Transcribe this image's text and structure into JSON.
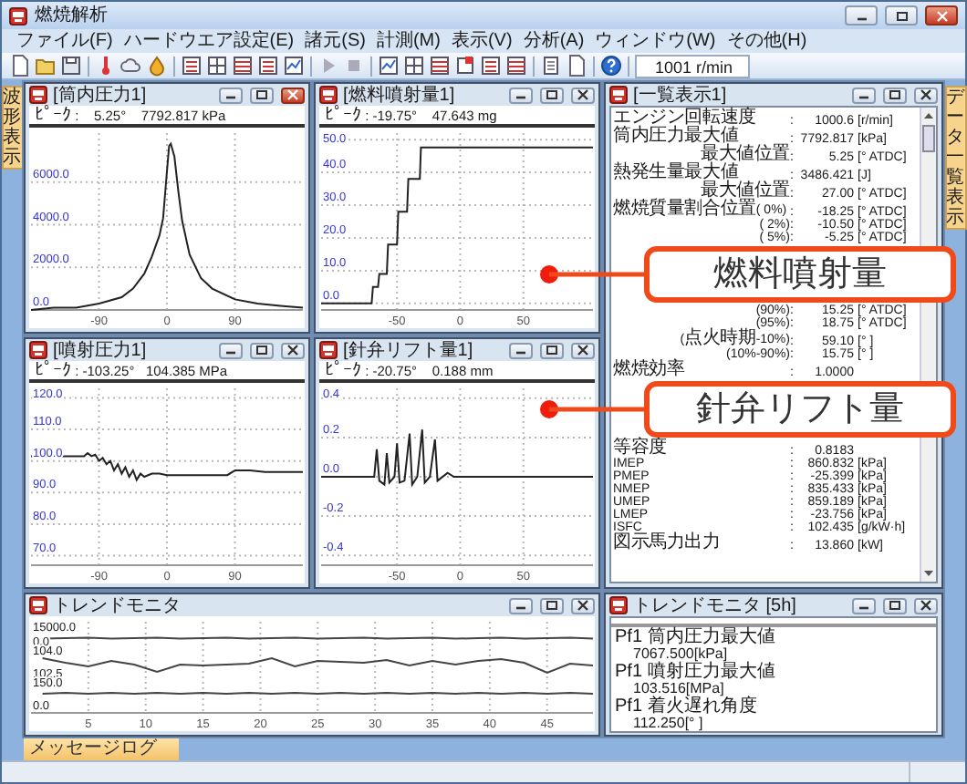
{
  "window": {
    "title": "燃焼解析"
  },
  "menu": [
    "ファイル(F)",
    "ハードウエア設定(E)",
    "諸元(S)",
    "計測(M)",
    "表示(V)",
    "分析(A)",
    "ウィンドウ(W)",
    "その他(H)"
  ],
  "toolbar": {
    "speed_field": "1001 r/min"
  },
  "side_tabs": {
    "left": {
      "label": "波形表示"
    },
    "right": {
      "label": "データ一覧表示"
    }
  },
  "charts": [
    {
      "title": "[筒内圧力1]",
      "active": true,
      "peak": "ﾋﾟｰｸ :    5.25°    7792.817 kPa",
      "chart_data": {
        "type": "line",
        "grid": true,
        "x": [
          -180,
          -150,
          -120,
          -90,
          -60,
          -45,
          -30,
          -20,
          -10,
          -5,
          0,
          3,
          5,
          10,
          15,
          20,
          30,
          45,
          60,
          90,
          120,
          150,
          180
        ],
        "series": [
          {
            "color": "#222222",
            "values": [
              0,
              100,
              100,
              300,
              600,
              1000,
              1700,
              2500,
              3500,
              4300,
              6500,
              7700,
              7800,
              7200,
              5600,
              4200,
              2600,
              1500,
              1000,
              500,
              300,
              200,
              100
            ]
          }
        ],
        "xlim": [
          -180,
          180
        ],
        "ylim": [
          0,
          8300
        ],
        "xticks": [
          -90,
          0,
          90
        ],
        "yticks": [
          {
            "value": 0,
            "label": "0.0"
          },
          {
            "value": 2000,
            "label": "2000.0"
          },
          {
            "value": 4000,
            "label": "4000.0"
          },
          {
            "value": 6000,
            "label": "6000.0"
          }
        ]
      }
    },
    {
      "title": "[燃料噴射量1]",
      "active": false,
      "peak": "ﾋﾟｰｸ : -19.75°    47.643 mg",
      "chart_data": {
        "type": "line",
        "grid": true,
        "x": [
          -110,
          -70,
          -69,
          -65,
          -64,
          -58,
          -57,
          -50,
          -49,
          -42,
          -41,
          -32,
          -31,
          105
        ],
        "series": [
          {
            "color": "#222222",
            "values": [
              0,
              0,
              5,
              5,
              9,
              9,
              18,
              18,
              28,
              28,
              38,
              38,
              47.6,
              47.6
            ]
          }
        ],
        "xlim": [
          -110,
          105
        ],
        "ylim": [
          -2,
          52
        ],
        "xticks": [
          -50,
          0,
          50
        ],
        "yticks": [
          {
            "value": 0,
            "label": "0.0"
          },
          {
            "value": 10,
            "label": "10.0"
          },
          {
            "value": 20,
            "label": "20.0"
          },
          {
            "value": 30,
            "label": "30.0"
          },
          {
            "value": 40,
            "label": "40.0"
          },
          {
            "value": 50,
            "label": "50.0"
          }
        ]
      }
    },
    {
      "title": "[噴射圧力1]",
      "active": false,
      "peak": "ﾋﾟｰｸ : -103.25°   104.385 MPa",
      "chart_data": {
        "type": "line",
        "grid": true,
        "x": [
          -180,
          -110,
          -105,
          -100,
          -95,
          -90,
          -85,
          -80,
          -75,
          -70,
          -65,
          -60,
          -55,
          -50,
          -45,
          -40,
          -35,
          -30,
          -20,
          -10,
          0,
          20,
          40,
          60,
          80,
          90,
          110,
          130,
          150,
          180
        ],
        "series": [
          {
            "color": "#222222",
            "values": [
              101.5,
              101.5,
              102.5,
              101.5,
              102,
              100,
              101,
              99,
              100,
              97,
              99,
              96,
              98,
              95,
              97,
              94,
              96,
              95,
              96,
              96,
              95.5,
              95.5,
              95.5,
              95.5,
              95.5,
              97,
              97,
              96.5,
              96.5,
              96.5
            ]
          }
        ],
        "xlim": [
          -180,
          180
        ],
        "ylim": [
          67,
          123
        ],
        "xticks": [
          -90,
          0,
          90
        ],
        "yticks": [
          {
            "value": 70,
            "label": "70.0"
          },
          {
            "value": 80,
            "label": "80.0"
          },
          {
            "value": 90,
            "label": "90.0"
          },
          {
            "value": 100,
            "label": "100.0"
          },
          {
            "value": 110,
            "label": "110.0"
          },
          {
            "value": 120,
            "label": "120.0"
          }
        ]
      }
    },
    {
      "title": "[針弁リフト量1]",
      "active": false,
      "peak": "ﾋﾟｰｸ : -20.75°    0.188 mm",
      "chart_data": {
        "type": "line",
        "grid": true,
        "x": [
          -110,
          -70,
          -68,
          -66,
          -64,
          -60,
          -58,
          -56,
          -52,
          -50,
          -48,
          -44,
          -40,
          -38,
          -34,
          -30,
          -28,
          -24,
          -20,
          -18,
          -10,
          -5,
          105
        ],
        "series": [
          {
            "color": "#222222",
            "values": [
              0,
              0,
              0,
              0.14,
              -0.02,
              -0.04,
              0.12,
              -0.03,
              0,
              0.17,
              -0.03,
              -0.02,
              0.22,
              -0.04,
              0,
              0.24,
              -0.03,
              0,
              0.19,
              -0.02,
              0.02,
              0,
              0
            ]
          }
        ],
        "xlim": [
          -110,
          105
        ],
        "ylim": [
          -0.45,
          0.45
        ],
        "xticks": [
          -50,
          0,
          50
        ],
        "yticks": [
          {
            "value": -0.4,
            "label": "-0.4"
          },
          {
            "value": -0.2,
            "label": "-0.2"
          },
          {
            "value": 0,
            "label": "0.0"
          },
          {
            "value": 0.2,
            "label": "0.2"
          },
          {
            "value": 0.4,
            "label": "0.4"
          }
        ]
      }
    }
  ],
  "summary_window": {
    "title": "[一覧表示1]",
    "active": false,
    "sections": [
      [
        {
          "kind": "main",
          "label": "エンジン回転速度",
          "separator": ":",
          "value": "1000.6",
          "unit": "[r/min]"
        },
        {
          "kind": "main",
          "label": "筒内圧力最大値",
          "separator": ":",
          "value": "7792.817",
          "unit": "[kPa]"
        },
        {
          "kind": "sub",
          "label": "最大値位置",
          "separator": ":",
          "value": "5.25",
          "unit": "[° ATDC]"
        },
        {
          "kind": "main",
          "label": "熱発生量最大値",
          "separator": ":",
          "value": "3486.421",
          "unit": "[J]"
        },
        {
          "kind": "sub",
          "label": "最大値位置",
          "separator": ":",
          "value": "27.00",
          "unit": "[° ATDC]"
        },
        {
          "kind": "main",
          "label": "燃焼質量割合位置( 0%)",
          "separator": ":",
          "value": "-18.25",
          "unit": "[° ATDC]"
        },
        {
          "kind": "sub",
          "label": "( 2%)",
          "separator": ":",
          "value": "-10.50",
          "unit": "[° ATDC]"
        },
        {
          "kind": "sub",
          "label": "( 5%)",
          "separator": ":",
          "value": "-5.25",
          "unit": "[° ATDC]"
        }
      ],
      [
        {
          "kind": "sub",
          "label": "(90%)",
          "separator": ":",
          "value": "15.25",
          "unit": "[° ATDC]"
        },
        {
          "kind": "sub",
          "label": "(95%)",
          "separator": ":",
          "value": "18.75",
          "unit": "[° ATDC]"
        },
        {
          "kind": "sub",
          "label": "(点火時期-10%)",
          "separator": ":",
          "value": "59.10",
          "unit": "[° ]"
        },
        {
          "kind": "sub",
          "label": "(10%-90%)",
          "separator": ":",
          "value": "15.75",
          "unit": "[° ]"
        },
        {
          "kind": "main",
          "label": "燃焼効率",
          "separator": ":",
          "value": "1.0000"
        }
      ],
      [
        {
          "kind": "main",
          "label": "等容度",
          "separator": ":",
          "value": "0.8183"
        },
        {
          "kind": "main",
          "label": "IMEP",
          "separator": ":",
          "value": "860.832",
          "unit": "[kPa]"
        },
        {
          "kind": "main",
          "label": "PMEP",
          "separator": ":",
          "value": "-25.399",
          "unit": "[kPa]"
        },
        {
          "kind": "main",
          "label": "NMEP",
          "separator": ":",
          "value": "835.433",
          "unit": "[kPa]"
        },
        {
          "kind": "main",
          "label": "UMEP",
          "separator": ":",
          "value": "859.189",
          "unit": "[kPa]"
        },
        {
          "kind": "main",
          "label": "LMEP",
          "separator": ":",
          "value": "-23.756",
          "unit": "[kPa]"
        },
        {
          "kind": "main",
          "label": "ISFC",
          "separator": ":",
          "value": "102.435",
          "unit": "[g/kW·h]"
        },
        {
          "kind": "main",
          "label": "図示馬力出力",
          "separator": ":",
          "value": "13.860",
          "unit": "[kW]"
        }
      ]
    ]
  },
  "callouts": [
    {
      "text": "燃料噴射量"
    },
    {
      "text": "針弁リフト量"
    }
  ],
  "trend_window": {
    "title": "トレンドモニタ",
    "active": false,
    "scale_labels": [
      "15000.0",
      "0.0",
      "104.0",
      "102.5",
      "150.0",
      "0.0"
    ],
    "x_labels": [
      "5",
      "10",
      "15",
      "20",
      "25",
      "30",
      "35",
      "40",
      "45"
    ]
  },
  "trend_list_window": {
    "title": "トレンドモニタ [5h]",
    "active": false,
    "items": [
      {
        "label": "Pf1 筒内圧力最大値",
        "value": "7067.500[kPa]"
      },
      {
        "label": "Pf1 噴射圧力最大値",
        "value": "103.516[MPa]"
      },
      {
        "label": "Pf1 着火遅れ角度",
        "value": "112.250[° ]"
      }
    ]
  },
  "bottom_tabs": [
    {
      "label": "メッセージログ",
      "selected": true
    }
  ]
}
